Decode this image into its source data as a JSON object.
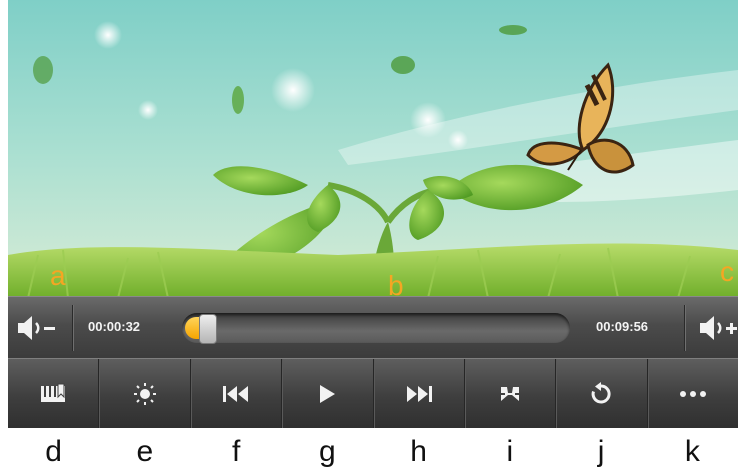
{
  "callouts": {
    "a": "a",
    "b": "b",
    "c": "c"
  },
  "player": {
    "elapsed": "00:00:32",
    "duration": "00:09:56",
    "progress_fraction": 0.054
  },
  "toolbar_icons": [
    "bookmark-icon",
    "brightness-icon",
    "previous-icon",
    "play-icon",
    "next-icon",
    "fullscreen-icon",
    "repeat-icon",
    "more-icon"
  ],
  "button_letters": [
    "d",
    "e",
    "f",
    "g",
    "h",
    "i",
    "j",
    "k"
  ],
  "colors": {
    "accent": "#f5a400",
    "callout": "#f5a623",
    "bar": "#3e3e3e"
  }
}
